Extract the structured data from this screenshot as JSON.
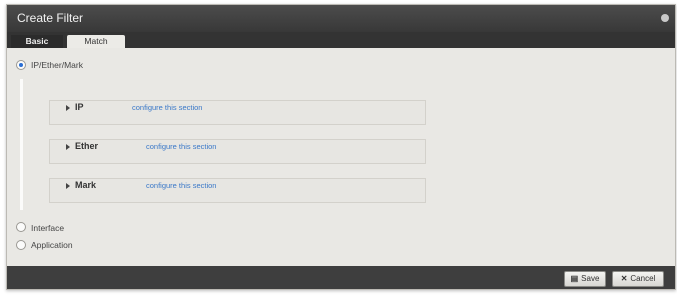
{
  "dialog": {
    "title": "Create Filter",
    "close_icon": "close-icon"
  },
  "tabs": [
    {
      "label": "Basic",
      "active": false
    },
    {
      "label": "Match",
      "active": true
    }
  ],
  "match_type": {
    "options": [
      {
        "label": "IP/Ether/Mark",
        "checked": true
      },
      {
        "label": "Interface",
        "checked": false
      },
      {
        "label": "Application",
        "checked": false
      }
    ]
  },
  "sections": [
    {
      "title": "IP",
      "link": "configure this section"
    },
    {
      "title": "Ether",
      "link": "configure this section"
    },
    {
      "title": "Mark",
      "link": "configure this section"
    }
  ],
  "footer": {
    "save_icon": "save-icon",
    "save_label": "Save",
    "cancel_icon": "cancel-icon",
    "cancel_label": "Cancel"
  },
  "colors": {
    "titlebar": "#383838",
    "body": "#e9e8e4",
    "link": "#3a78c8",
    "radio_selected": "#2a6ed4"
  }
}
